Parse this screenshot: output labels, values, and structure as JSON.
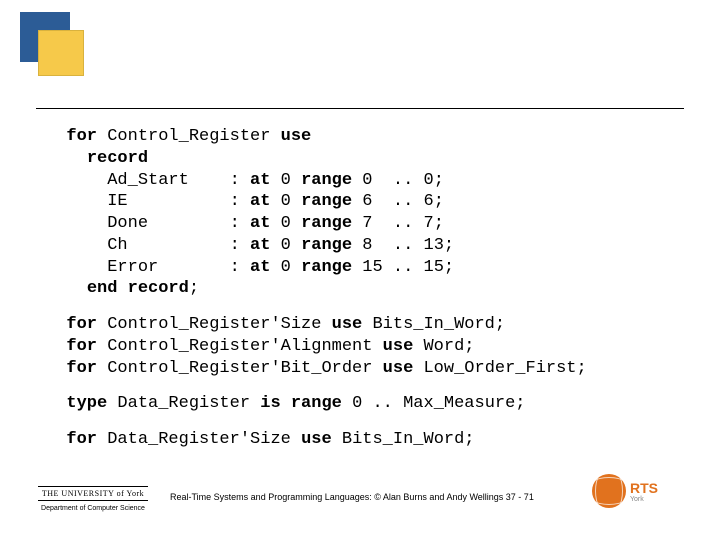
{
  "code": {
    "block1_html": "  <b>for</b> Control_Register <b>use</b>\n    <b>record</b>\n      Ad_Start    : <b>at</b> 0 <b>range</b> 0  .. 0;\n      IE          : <b>at</b> 0 <b>range</b> 6  .. 6;\n      Done        : <b>at</b> 0 <b>range</b> 7  .. 7;\n      Ch          : <b>at</b> 0 <b>range</b> 8  .. 13;\n      Error       : <b>at</b> 0 <b>range</b> 15 .. 15;\n    <b>end record</b>;",
    "block2_html": "  <b>for</b> Control_Register'Size <b>use</b> Bits_In_Word;\n  <b>for</b> Control_Register'Alignment <b>use</b> Word;\n  <b>for</b> Control_Register'Bit_Order <b>use</b> Low_Order_First;",
    "block3_html": "  <b>type</b> Data_Register <b>is range</b> 0 .. Max_Measure;",
    "block4_html": "  <b>for</b> Data_Register'Size <b>use</b> Bits_In_Word;"
  },
  "footer": {
    "uni": "THE UNIVERSITY of York",
    "dept": "Department of Computer Science",
    "caption": "Real-Time Systems and Programming Languages: © Alan Burns and Andy Wellings 37 - 71",
    "rts": "RTS",
    "rts_sub": "York"
  }
}
